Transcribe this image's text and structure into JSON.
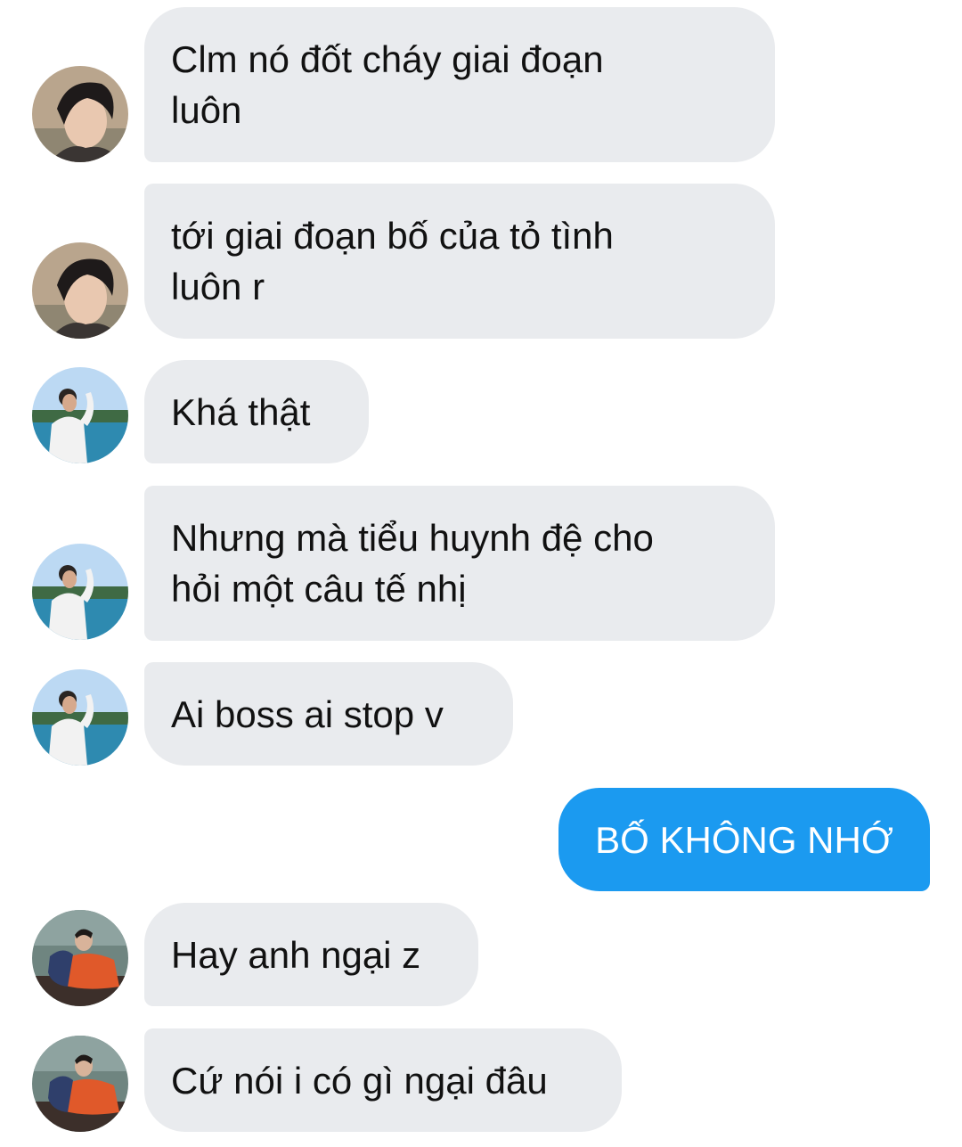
{
  "messages": [
    {
      "sender": "contact-a",
      "direction": "incoming",
      "text": "Clm nó đốt cháy giai đoạn\nluôn"
    },
    {
      "sender": "contact-a",
      "direction": "incoming",
      "text": "tới giai đoạn bố của tỏ tình\nluôn r"
    },
    {
      "sender": "contact-b",
      "direction": "incoming",
      "text": "Khá thật"
    },
    {
      "sender": "contact-b",
      "direction": "incoming",
      "text": "Nhưng mà tiểu huynh đệ cho\nhỏi một câu tế nhị"
    },
    {
      "sender": "contact-b",
      "direction": "incoming",
      "text": "Ai boss ai stop v"
    },
    {
      "sender": "me",
      "direction": "outgoing",
      "text": "BỐ KHÔNG NHỚ"
    },
    {
      "sender": "contact-c",
      "direction": "incoming",
      "text": "Hay anh ngại z"
    },
    {
      "sender": "contact-c",
      "direction": "incoming",
      "text": "Cứ nói i có gì ngại đâu"
    }
  ],
  "colors": {
    "incoming_bubble": "#e9ebee",
    "outgoing_bubble": "#1b9af0",
    "incoming_text": "#111111",
    "outgoing_text": "#ffffff"
  },
  "icons": {
    "contact-a": "avatar-portrait-dark-hair",
    "contact-b": "avatar-seaside-white-shirt",
    "contact-c": "avatar-orange-robe"
  }
}
